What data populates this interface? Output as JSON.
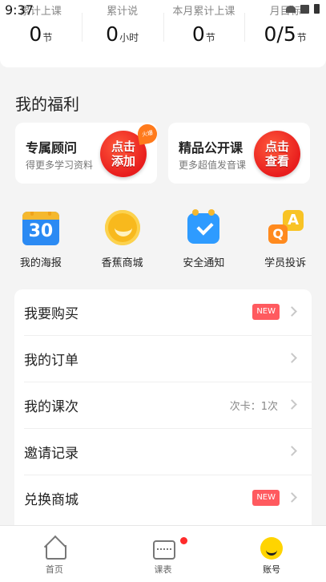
{
  "status": {
    "time": "9:37"
  },
  "stats": [
    {
      "label": "累计上课",
      "value": "0",
      "unit": "节"
    },
    {
      "label": "累计说",
      "value": "0",
      "unit": "小时"
    },
    {
      "label": "本月累计上课",
      "value": "0",
      "unit": "节"
    },
    {
      "label": "月目标",
      "value": "0/5",
      "unit": "节"
    }
  ],
  "welfare": {
    "title": "我的福利",
    "cards": [
      {
        "title": "专属顾问",
        "subtitle": "得更多学习资料",
        "badge": "点击添加",
        "hot": "火爆"
      },
      {
        "title": "精品公开课",
        "subtitle": "更多超值发音课",
        "badge": "点击查看"
      }
    ]
  },
  "quick": [
    {
      "label": "我的海报",
      "icon": "calendar-30-icon",
      "num": "30"
    },
    {
      "label": "香蕉商城",
      "icon": "banana-coin-icon"
    },
    {
      "label": "安全通知",
      "icon": "security-notice-icon"
    },
    {
      "label": "学员投诉",
      "icon": "qa-complaint-icon",
      "a": "A",
      "q": "Q"
    }
  ],
  "menu": [
    {
      "label": "我要购买",
      "tag": "NEW"
    },
    {
      "label": "我的订单"
    },
    {
      "label": "我的课次",
      "extra": "次卡：1次"
    },
    {
      "label": "邀请记录"
    },
    {
      "label": "兑换商城",
      "tag": "NEW"
    }
  ],
  "tabs": [
    {
      "label": "首页"
    },
    {
      "label": "课表"
    },
    {
      "label": "账号"
    }
  ],
  "colors": {
    "accent": "#ffd400",
    "badge_red": "#e81d1d",
    "new_tag": "#ff5a5f"
  }
}
